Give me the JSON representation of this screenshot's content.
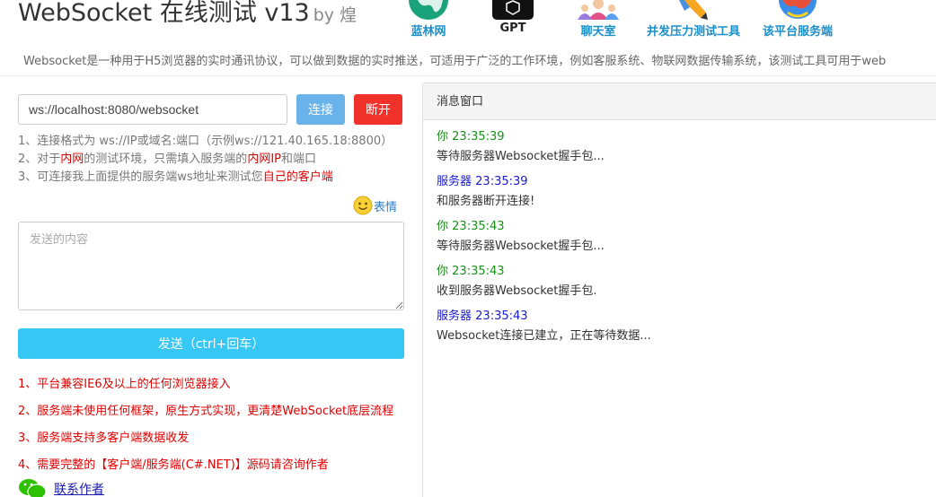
{
  "header": {
    "title": "WebSocket 在线测试 v13",
    "by": "by 煌",
    "nav": [
      {
        "label": "蓝林网",
        "icon": "globe-icon"
      },
      {
        "label": "GPT",
        "icon": "openai-icon"
      },
      {
        "label": "聊天室",
        "icon": "chat-people-icon"
      },
      {
        "label": "并发压力测试工具",
        "icon": "pencil-tool-icon"
      },
      {
        "label": "该平台服务端",
        "icon": "server-globe-icon"
      }
    ],
    "subtitle": "Websocket是一种用于H5浏览器的实时通讯协议，可以做到数据的实时推送，可适用于广泛的工作环境，例如客服系统、物联网数据传输系统，该测试工具可用于web"
  },
  "connect": {
    "url_value": "ws://localhost:8080/websocket",
    "connect_label": "连接",
    "disconnect_label": "断开"
  },
  "tips": {
    "t1": "1、连接格式为 ws://IP或域名:端口（示例ws://121.40.165.18:8800）",
    "t2_a": "2、对于",
    "t2_b": "内网",
    "t2_c": "的测试环境，只需填入服务端的",
    "t2_d": "内网IP",
    "t2_e": "和端口",
    "t3_a": "3、可连接我上面提供的服务端ws地址来测试您",
    "t3_b": "自己的客户端"
  },
  "emoji": {
    "label": "表情"
  },
  "send": {
    "placeholder": "发送的内容",
    "button_label": "发送（ctrl+回车）"
  },
  "notes": [
    "1、平台兼容IE6及以上的任何浏览器接入",
    "2、服务端未使用任何框架，原生方式实现，更清楚WebSocket底层流程",
    "3、服务端支持多客户端数据收发",
    "4、需要完整的【客户端/服务端(C#.NET)】源码请咨询作者"
  ],
  "contact": {
    "label": "联系作者"
  },
  "messages": {
    "title": "消息窗口",
    "items": [
      {
        "who": "你",
        "time": "23:35:39",
        "text": "等待服务器Websocket握手包..."
      },
      {
        "who": "服务器",
        "time": "23:35:39",
        "text": "和服务器断开连接!"
      },
      {
        "who": "你",
        "time": "23:35:43",
        "text": "等待服务器Websocket握手包..."
      },
      {
        "who": "你",
        "time": "23:35:43",
        "text": "收到服务器Websocket握手包."
      },
      {
        "who": "服务器",
        "time": "23:35:43",
        "text": "Websocket连接已建立，正在等待数据..."
      }
    ]
  },
  "colors": {
    "connect_button": "#6ab2ea",
    "disconnect_button": "#f0322a",
    "send_button": "#36c7f4",
    "note_text": "#e00000",
    "client_message": "#1a8f1a",
    "server_message": "#1a1acf"
  }
}
